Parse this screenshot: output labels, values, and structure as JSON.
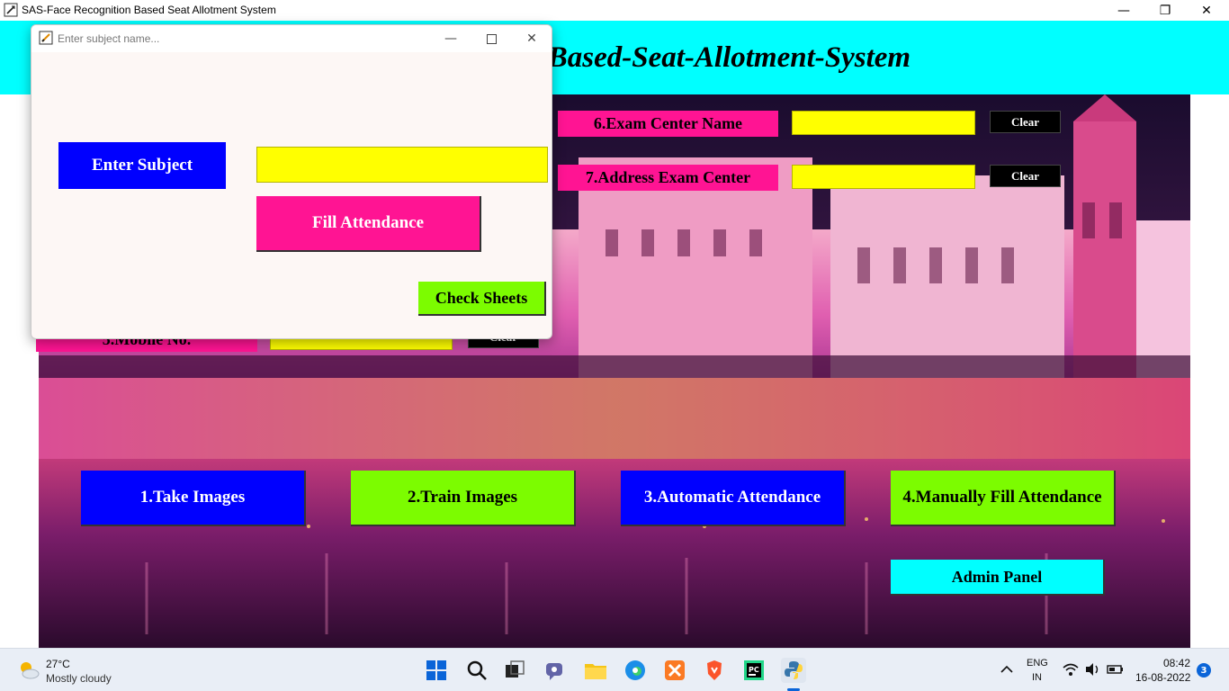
{
  "window": {
    "title": "SAS-Face Recognition Based Seat Allotment System",
    "minimize": "—",
    "maximize": "❐",
    "close": "✕"
  },
  "header": {
    "title": "Face-Recognition-Based-Seat-Allotment-System"
  },
  "form": {
    "exam_center_label": "6.Exam Center Name",
    "exam_center_value": "",
    "address_label": "7.Address Exam Center",
    "address_value": "",
    "mobile_label": "5.Mobile No.",
    "mobile_value": "",
    "clear_label": "Clear"
  },
  "actions": {
    "take_images": "1.Take Images",
    "train_images": "2.Train Images",
    "automatic_attendance": "3.Automatic Attendance",
    "manual_attendance": "4.Manually Fill Attendance",
    "admin_panel": "Admin Panel"
  },
  "dialog": {
    "title": "Enter subject name...",
    "enter_subject_label": "Enter Subject",
    "subject_value": "",
    "fill_attendance": "Fill Attendance",
    "check_sheets": "Check Sheets"
  },
  "taskbar": {
    "weather_temp": "27°C",
    "weather_desc": "Mostly cloudy",
    "lang_line1": "ENG",
    "lang_line2": "IN",
    "time": "08:42",
    "date": "16-08-2022",
    "notification_count": "3",
    "apps": [
      "start-icon",
      "search-icon",
      "task-view-icon",
      "chat-icon",
      "file-explorer-icon",
      "edge-icon",
      "xampp-icon",
      "brave-icon",
      "pycharm-icon",
      "python-icon"
    ]
  },
  "colors": {
    "header_bg": "#00ffff",
    "label_pink": "#ff1493",
    "field_yellow": "#ffff00",
    "button_blue": "#0000ff",
    "button_green": "#7cfc00",
    "button_cyan": "#00ffff"
  }
}
